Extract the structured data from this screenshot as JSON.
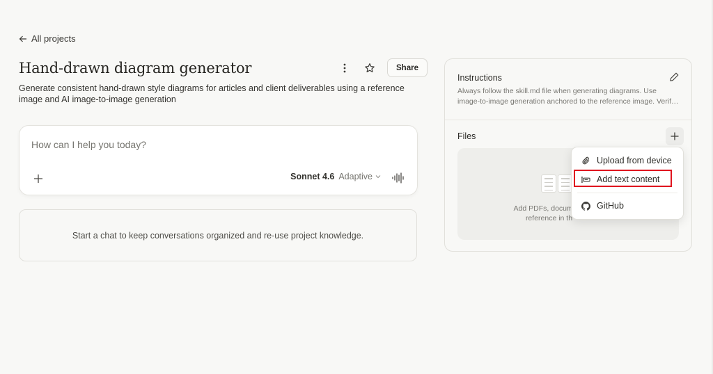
{
  "nav": {
    "back_label": "All projects"
  },
  "header": {
    "title": "Hand-drawn diagram generator",
    "description": "Generate consistent hand-drawn style diagrams for articles and client deliverables using a reference image and AI image-to-image generation",
    "share_label": "Share"
  },
  "chat": {
    "placeholder": "How can I help you today?",
    "model_name": "Sonnet 4.6",
    "model_mode": "Adaptive"
  },
  "empty_state": {
    "text": "Start a chat to keep conversations organized and re-use project knowledge."
  },
  "instructions": {
    "title": "Instructions",
    "line1": "Always follow the skill.md file when generating diagrams. Use",
    "line2": "image-to-image generation anchored to the reference image. Verif…"
  },
  "files": {
    "title": "Files",
    "dropzone_line1": "Add PDFs, documen",
    "dropzone_line2": "reference in th"
  },
  "dropdown": {
    "items": [
      {
        "label": "Upload from device",
        "icon": "paperclip-icon"
      },
      {
        "label": "Add text content",
        "icon": "text-content-icon"
      },
      {
        "label": "GitHub",
        "icon": "github-icon"
      }
    ]
  },
  "colors": {
    "background": "#f8f8f6",
    "highlight": "#e0141e"
  }
}
